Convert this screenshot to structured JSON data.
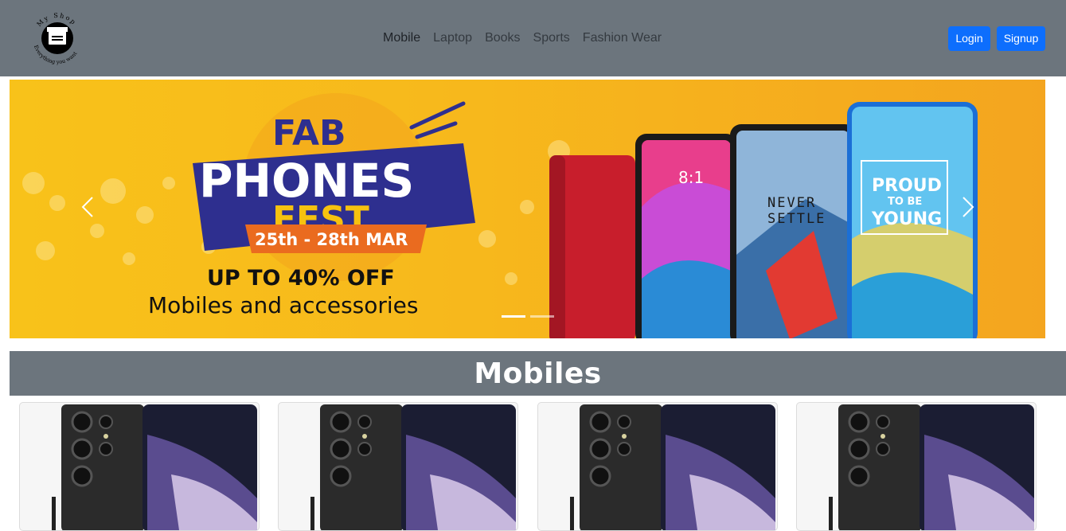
{
  "brand": {
    "logo_text_top": "My Shop",
    "logo_text_bottom": "Everything you want"
  },
  "nav": {
    "links": [
      "Mobile",
      "Laptop",
      "Books",
      "Sports",
      "Fashion Wear"
    ]
  },
  "auth": {
    "login_label": "Login",
    "signup_label": "Signup"
  },
  "banner": {
    "line1": "FAB",
    "line2": "PHONES",
    "line3": "FEST",
    "dates": "25th - 28th MAR",
    "offer": "UP TO 40% OFF",
    "subline": "Mobiles and accessories",
    "phone_text_never": "NEVER",
    "phone_text_settle": "SETTLE",
    "phone_text_proud": "PROUD",
    "phone_text_tobe": "TO BE",
    "phone_text_young": "YOUNG",
    "phone_clock": "8:1",
    "indicators": 2,
    "active_indicator": 0
  },
  "section": {
    "title": "Mobiles"
  },
  "colors": {
    "navbar": "#6c757d",
    "button": "#0d6efd",
    "banner_bg": "#f7b81c"
  }
}
